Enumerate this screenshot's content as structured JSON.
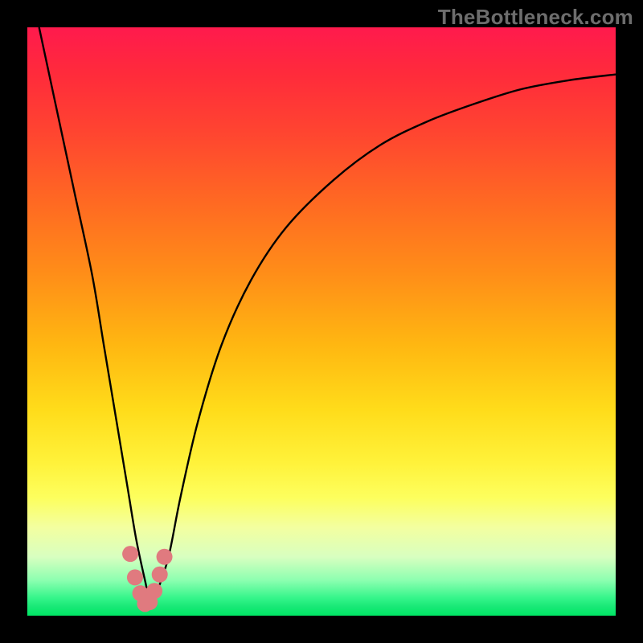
{
  "attribution": "TheBottleneck.com",
  "colors": {
    "page_bg": "#000000",
    "gradient_top": "#ff1a4d",
    "gradient_bottom": "#00e765",
    "curve_stroke": "#000000",
    "marker_fill": "#e07a7f"
  },
  "chart_data": {
    "type": "line",
    "title": "",
    "xlabel": "",
    "ylabel": "",
    "xlim": [
      0,
      100
    ],
    "ylim": [
      0,
      100
    ],
    "series": [
      {
        "name": "curve",
        "x": [
          2,
          5,
          8,
          11,
          13,
          15,
          17,
          18.5,
          20,
          21,
          22,
          24,
          26,
          29,
          33,
          38,
          44,
          52,
          60,
          68,
          76,
          84,
          92,
          100
        ],
        "values": [
          100,
          86,
          72,
          58,
          46,
          34,
          22,
          13,
          6,
          2,
          4,
          10,
          20,
          33,
          46,
          57,
          66,
          74,
          80,
          84,
          87,
          89.5,
          91,
          92
        ]
      },
      {
        "name": "highlight-markers",
        "x": [
          17.5,
          18.3,
          19.2,
          20.0,
          20.8,
          21.6,
          22.5,
          23.3
        ],
        "values": [
          10.5,
          6.5,
          3.8,
          2.0,
          2.3,
          4.2,
          7.0,
          10.0
        ]
      }
    ]
  }
}
